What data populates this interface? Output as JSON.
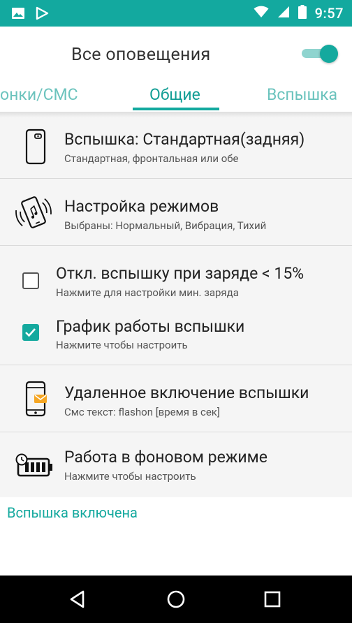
{
  "status_bar": {
    "time": "9:57",
    "icons": [
      "image-icon",
      "play-store-icon",
      "wifi-icon",
      "signal-icon",
      "battery-icon"
    ]
  },
  "header": {
    "title": "Все оповещения",
    "toggle_on": true
  },
  "tabs": [
    {
      "label": "онки/СМС",
      "active": false
    },
    {
      "label": "Общие",
      "active": true
    },
    {
      "label": "Вспышка",
      "active": false
    }
  ],
  "settings": [
    {
      "title": "Вспышка: Стандартная(задняя)",
      "subtitle": "Стандартная, фронтальная или обе",
      "icon": "phone-back-icon"
    },
    {
      "title": "Настройка режимов",
      "subtitle": "Выбраны: Нормальный, Вибрация, Тихий",
      "icon": "vibrating-phone-icon"
    },
    {
      "title": "Откл. вспышку при заряде < 15%",
      "subtitle": "Нажмите для настройки мин. заряда",
      "checked": false
    },
    {
      "title": "График работы вспышки",
      "subtitle": "Нажмите чтобы настроить",
      "checked": true
    },
    {
      "title": "Удаленное включение вспышки",
      "subtitle": "Смс текст: flashon [время в сек]",
      "icon": "phone-sms-icon"
    },
    {
      "title": "Работа в фоновом режиме",
      "subtitle": "Нажмите чтобы настроить",
      "icon": "battery-clock-icon"
    }
  ],
  "footer": {
    "status": "Вспышка включена"
  },
  "nav": {
    "icons": [
      "back-icon",
      "home-icon",
      "recents-icon"
    ]
  },
  "colors": {
    "accent": "#13a99f",
    "accent_light": "#6bc3bd",
    "background": "#f5f5f5"
  }
}
